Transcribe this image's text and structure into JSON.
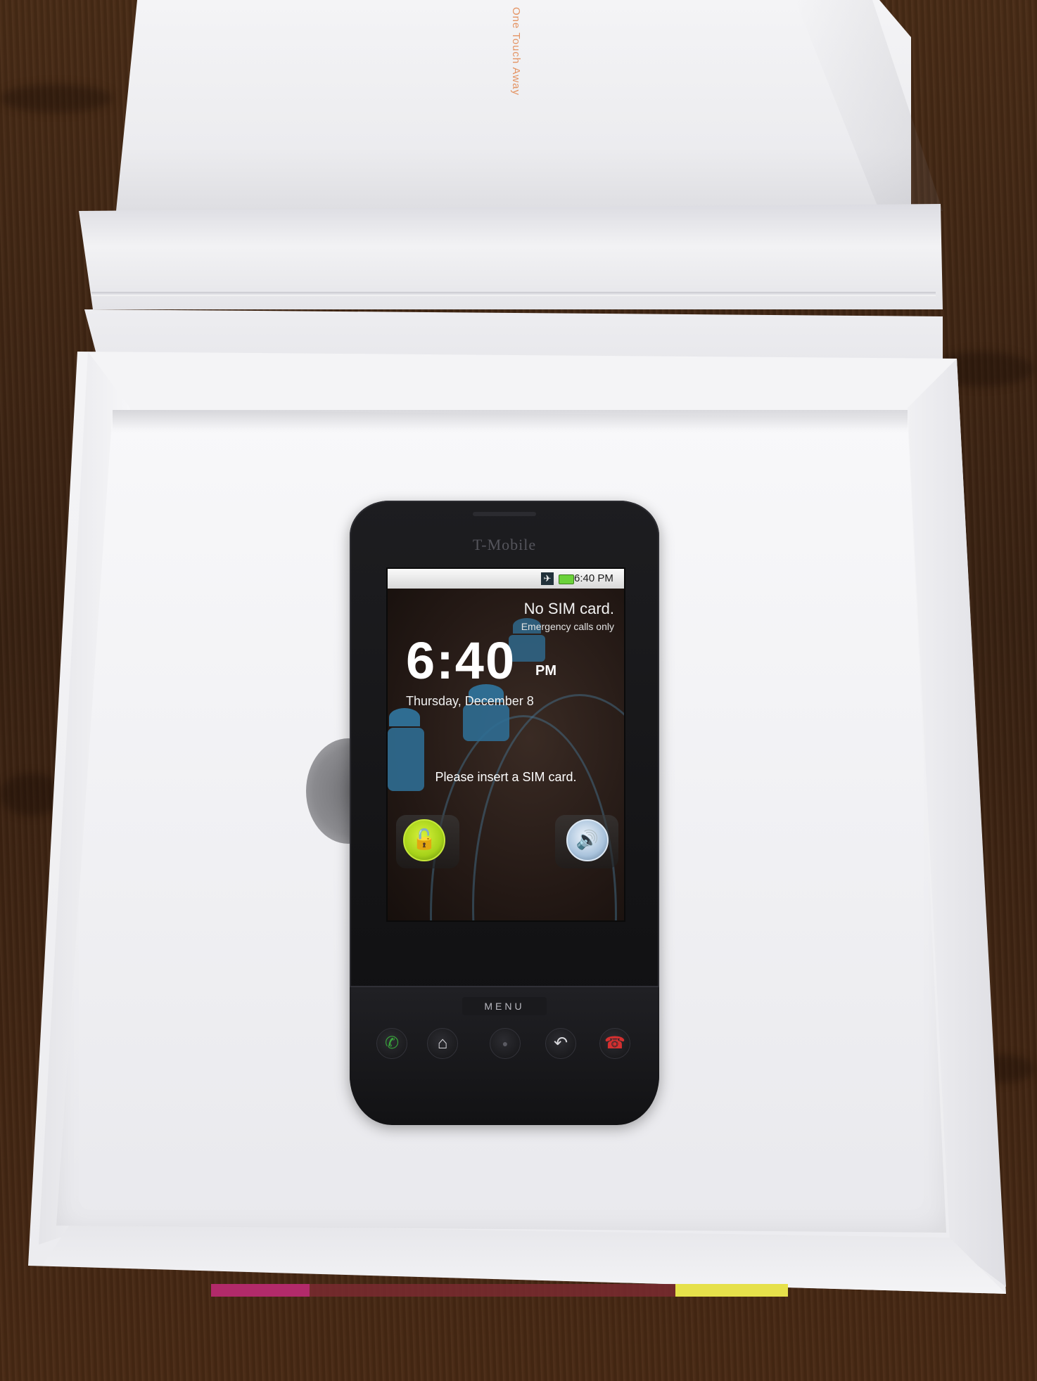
{
  "phone": {
    "brand": "T-Mobile",
    "status_time": "6:40 PM",
    "sim_status": "No SIM card.",
    "emergency": "Emergency calls only",
    "clock": "6:40",
    "ampm": "PM",
    "date": "Thursday, December 8",
    "insert_sim": "Please insert a SIM card.",
    "menu_label": "MENU",
    "icons": {
      "unlock": "unlock-icon",
      "sound": "speaker-icon",
      "call": "call-icon",
      "home": "home-icon",
      "trackball": "trackball-icon",
      "back": "back-icon",
      "end": "end-call-icon"
    }
  },
  "box": {
    "lid_text": "One Touch Away"
  },
  "colors": {
    "wood": "#3b2312",
    "box_white": "#f2f2f4",
    "phone_body": "#141416",
    "unlock_green": "#a6d21a",
    "sound_blue": "#a9c3dc",
    "accent_orange": "#e2834a"
  }
}
